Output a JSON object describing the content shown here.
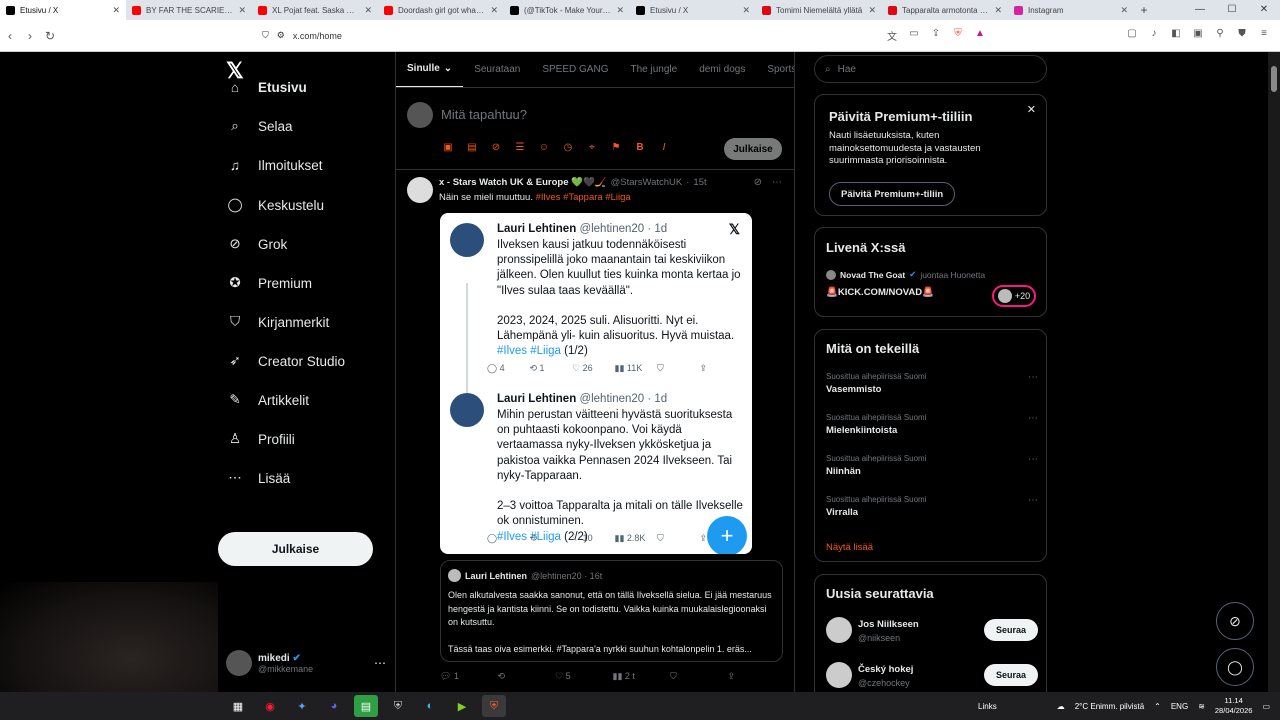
{
  "browser": {
    "tabs": [
      {
        "title": "Etusivu / X",
        "icon": "x-logo-icon",
        "color": "#000000",
        "active": true
      },
      {
        "title": "BY FAR THE SCARIEST GAME",
        "icon": "youtube-icon",
        "color": "#ff0000"
      },
      {
        "title": "XL Pojat feat. Saska Nymp",
        "icon": "youtube-icon",
        "color": "#ff0000"
      },
      {
        "title": "Doordash girl got what she",
        "icon": "youtube-icon",
        "color": "#ff0000"
      },
      {
        "title": "(@TikTok - Make Your Day",
        "icon": "tiktok-icon",
        "color": "#000000"
      },
      {
        "title": "Etusivu / X",
        "icon": "x-logo-icon",
        "color": "#000000"
      },
      {
        "title": "Tomimi Niemelältä yllätä",
        "icon": "iltalehti-icon",
        "color": "#e30613"
      },
      {
        "title": "Tapparalta armotonta irvai",
        "icon": "iltalehti-icon",
        "color": "#e30613"
      },
      {
        "title": "Instagram",
        "icon": "instagram-icon",
        "color": "#d6249f"
      }
    ],
    "url": "x.com/home"
  },
  "nav": {
    "items": [
      {
        "label": "Etusivu",
        "icon": "home-icon",
        "glyph": "⌂"
      },
      {
        "label": "Selaa",
        "icon": "search-icon",
        "glyph": "⌕"
      },
      {
        "label": "Ilmoitukset",
        "icon": "bell-icon",
        "glyph": "♫"
      },
      {
        "label": "Keskustelu",
        "icon": "chat-icon",
        "glyph": "◯"
      },
      {
        "label": "Grok",
        "icon": "grok-icon",
        "glyph": "⊘"
      },
      {
        "label": "Premium",
        "icon": "premium-icon",
        "glyph": "✪"
      },
      {
        "label": "Kirjanmerkit",
        "icon": "bookmark-icon",
        "glyph": "⛉"
      },
      {
        "label": "Creator Studio",
        "icon": "rocket-icon",
        "glyph": "➶"
      },
      {
        "label": "Artikkelit",
        "icon": "article-icon",
        "glyph": "✎"
      },
      {
        "label": "Profiili",
        "icon": "person-icon",
        "glyph": "♙"
      },
      {
        "label": "Lisää",
        "icon": "more-circle-icon",
        "glyph": "⋯"
      }
    ],
    "post_button": "Julkaise",
    "account": {
      "name": "mikedi",
      "handle": "@mikkemane"
    }
  },
  "main": {
    "tabs": [
      "Sinulle",
      "Seurataan",
      "SPEED GANG",
      "The jungle",
      "demi dogs",
      "Sportsla"
    ],
    "compose": {
      "placeholder": "Mitä tapahtuu?",
      "publish": "Julkaise"
    },
    "tweet": {
      "author": "x - Stars Watch UK & Europe 💚🖤🏒",
      "handle": "@StarsWatchUK",
      "time": "15t",
      "text": "Näin se mieli muuttuu.",
      "tags": "#Ilves #Tappara #Liiga",
      "image_posts": [
        {
          "name": "Lauri Lehtinen",
          "handle": "@lehtinen20 · 1d",
          "text": "Ilveksen kausi jatkuu todennäköisesti\npronssipelillä joko maanantain tai keskiviikon\njälkeen. Olen kuullut ties kuinka monta kertaa jo\n\"Ilves sulaa taas keväällä\".\n\n2023, 2024, 2025 suli. Alisuoritti. Nyt ei.\nLähempänä yli- kuin alisuoritus. Hyvä muistaa.",
          "tags": "#Ilves #Liiga",
          "suffix": " (1/2)",
          "stats": [
            "4",
            "1",
            "26",
            "11K"
          ]
        },
        {
          "name": "Lauri Lehtinen",
          "handle": "@lehtinen20 · 1d",
          "text": "Mihin perustan väitteeni hyvästä suorituksesta\non puhtaasti kokoonpano. Voi käydä\nvertaamassa nyky-Ilveksen ykkösketjua ja\npakistoa vaikka Pennasen 2024 Ilvekseen. Tai\nnyky-Tapparaan.\n\n2–3 voittoa Tapparalta ja mitali on tälle Ilvekselle\nok onnistuminen.",
          "tags": "#Ilves #Liiga",
          "suffix": " (2/2)",
          "stats": [
            "",
            "",
            "10",
            "2.8K"
          ]
        }
      ],
      "quote": {
        "name": "Lauri Lehtinen",
        "handle": "@lehtinen20 · 16t",
        "text": "Olen alkutalvesta saakka sanonut, että on tällä Ilveksellä sielua. Ei jää mestaruus hengestä ja kantista kiinni. Se on todistettu. Vaikka kuinka muukalaislegioonaksi on kutsuttu.\n\nTässä taas oiva esimerkki. #Tappara'a nyrkki suuhun kohtalonpelin 1. eräs..."
      },
      "stats": {
        "replies": "1",
        "reposts": "",
        "likes": "5",
        "views": "2 t"
      }
    }
  },
  "right": {
    "search_placeholder": "Hae",
    "premium": {
      "title": "Päivitä Premium+-tiiliin",
      "body": "Nauti lisäetuuksista, kuten mainoksettomuudesta ja vastausten suurimmasta priorisoinnista.",
      "button": "Päivitä Premium+-tiliin"
    },
    "live": {
      "title": "Livenä X:ssä",
      "host": "Novad The Goat",
      "status": "juontaa Huonetta",
      "room": "🚨KICK.COM/NOVAD🚨",
      "count": "+20"
    },
    "trends": {
      "title": "Mitä on tekeillä",
      "items": [
        {
          "context": "Suosittua aihepiirissä Suomi",
          "topic": "Vasemmisto"
        },
        {
          "context": "Suosittua aihepiirissä Suomi",
          "topic": "Mielenkiintoista"
        },
        {
          "context": "Suosittua aihepiirissä Suomi",
          "topic": "Niinhän"
        },
        {
          "context": "Suosittua aihepiirissä Suomi",
          "topic": "Virralla"
        }
      ],
      "more": "Näytä lisää"
    },
    "follow": {
      "title": "Uusia seurattavia",
      "users": [
        {
          "name": "Jos Niilkseen",
          "handle": "@niikseen",
          "button": "Seuraa"
        },
        {
          "name": "Český hokej",
          "handle": "@czehockey",
          "button": "Seuraa"
        }
      ]
    }
  },
  "taskbar": {
    "links": "Links",
    "weather": "2°C  Enimm. pilvistä",
    "lang": "ENG",
    "time": "11.14",
    "date": "28/04/2026"
  },
  "colors": {
    "accent": "#f4561f",
    "blue": "#1d9bf0",
    "background": "#000000"
  }
}
